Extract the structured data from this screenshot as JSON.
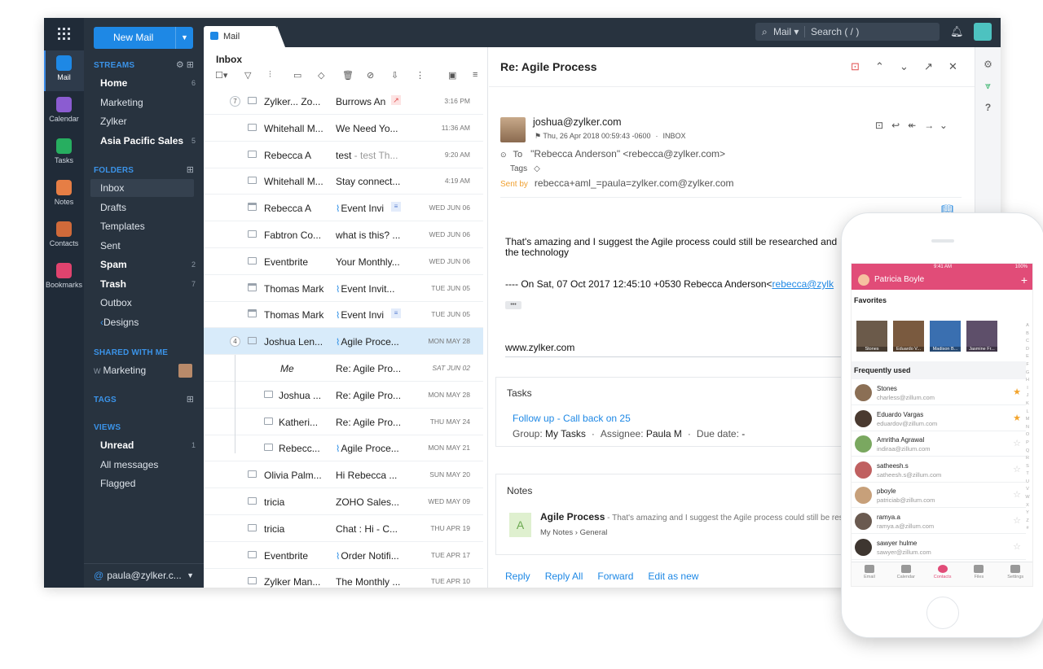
{
  "rail": {
    "items": [
      {
        "label": "Mail",
        "color": "#1e88e5"
      },
      {
        "label": "Calendar",
        "color": "#8b5cd1"
      },
      {
        "label": "Tasks",
        "color": "#27ae60"
      },
      {
        "label": "Notes",
        "color": "#e67e45"
      },
      {
        "label": "Contacts",
        "color": "#d06a3a"
      },
      {
        "label": "Bookmarks",
        "color": "#e0436e"
      }
    ]
  },
  "nav": {
    "new_mail": "New Mail",
    "streams_title": "STREAMS",
    "streams": [
      {
        "label": "Home",
        "count": "6",
        "bold": true
      },
      {
        "label": "Marketing",
        "count": ""
      },
      {
        "label": "Zylker",
        "count": ""
      },
      {
        "label": "Asia Pacific Sales",
        "count": "5",
        "bold": true
      }
    ],
    "folders_title": "FOLDERS",
    "folders": [
      {
        "label": "Inbox",
        "count": ""
      },
      {
        "label": "Drafts",
        "count": ""
      },
      {
        "label": "Templates",
        "count": ""
      },
      {
        "label": "Sent",
        "count": ""
      },
      {
        "label": "Spam",
        "count": "2",
        "bold": true
      },
      {
        "label": "Trash",
        "count": "7",
        "bold": true
      },
      {
        "label": "Outbox",
        "count": ""
      },
      {
        "label": "Designs",
        "count": ""
      }
    ],
    "shared_title": "SHARED WITH ME",
    "shared_prefix": "W",
    "shared_item": "Marketing",
    "tags_title": "TAGS",
    "views_title": "VIEWS",
    "views": [
      {
        "label": "Unread",
        "count": "1",
        "bold": true
      },
      {
        "label": "All messages",
        "count": ""
      },
      {
        "label": "Flagged",
        "count": ""
      }
    ],
    "account": "paula@zylker.c..."
  },
  "topbar": {
    "tab_label": "Mail",
    "search_scope": "Mail",
    "search_placeholder": "Search ( / )"
  },
  "list": {
    "title": "Inbox",
    "rows": [
      {
        "thread": "7",
        "sender": "Zylker... Zo...",
        "subject": "Burrows An",
        "date": "3:16 PM",
        "type": "mail"
      },
      {
        "sender": "Whitehall M...",
        "subject": "We Need Yo...",
        "date": "11:36 AM",
        "type": "mail"
      },
      {
        "sender": "Rebecca A",
        "subject": "test",
        "preview": " - test Th...",
        "date": "9:20 AM",
        "type": "mail"
      },
      {
        "sender": "Whitehall M...",
        "subject": "Stay connect...",
        "date": "4:19 AM",
        "type": "mail"
      },
      {
        "sender": "Rebecca A",
        "subject": "Event Invi",
        "date": "WED JUN 06",
        "type": "cal",
        "clip": true
      },
      {
        "sender": "Fabtron Co...",
        "subject": "what is this? ...",
        "date": "WED JUN 06",
        "type": "mail"
      },
      {
        "sender": "Eventbrite",
        "subject": "Your Monthly...",
        "date": "WED JUN 06",
        "type": "mail"
      },
      {
        "sender": "Thomas Mark",
        "subject": "Event Invit...",
        "date": "TUE JUN 05",
        "type": "cal",
        "clip": true
      },
      {
        "sender": "Thomas Mark",
        "subject": "Event Invi",
        "date": "TUE JUN 05",
        "type": "cal",
        "clip": true
      },
      {
        "thread": "4",
        "sender": "Joshua Len...",
        "subject": "Agile Proce...",
        "date": "MON MAY 28",
        "type": "mail",
        "clip": true,
        "selected": true
      },
      {
        "sender": "Me",
        "subject": "Re: Agile Pro...",
        "date": "SAT JUN 02",
        "type": "me"
      },
      {
        "sender": "Joshua ...",
        "subject": "Re: Agile Pro...",
        "date": "MON MAY 28",
        "type": "child"
      },
      {
        "sender": "Katheri...",
        "subject": "Re: Agile Pro...",
        "date": "THU MAY 24",
        "type": "child"
      },
      {
        "sender": "Rebecc...",
        "subject": "Agile Proce...",
        "date": "MON MAY 21",
        "type": "child",
        "clip": true
      },
      {
        "sender": "Olivia Palm...",
        "subject": "Hi Rebecca ...",
        "date": "SUN MAY 20",
        "type": "mail"
      },
      {
        "sender": "tricia",
        "subject": "ZOHO Sales...",
        "date": "WED MAY 09",
        "type": "mail"
      },
      {
        "sender": "tricia",
        "subject": "Chat : Hi - C...",
        "date": "THU APR 19",
        "type": "mail"
      },
      {
        "sender": "Eventbrite",
        "subject": "Order Notifi...",
        "date": "TUE APR 17",
        "type": "mail",
        "clip": true
      },
      {
        "sender": "Zylker Man...",
        "subject": "The Monthly ...",
        "date": "TUE APR 10",
        "type": "mail"
      }
    ]
  },
  "reading": {
    "subject": "Re: Agile Process",
    "from": "joshua@zylker.com",
    "date_line": "Thu, 26 Apr 2018 00:59:43 -0600",
    "folder": "INBOX",
    "to_label": "To",
    "to_value": "\"Rebecca Anderson\" <rebecca@zylker.com>",
    "tags_label": "Tags",
    "sent_by_label": "Sent by",
    "sent_by_value": "rebecca+aml_=paula=zylker.com@zylker.com",
    "body_line1": "That's amazing  and I suggest the Agile process could still be researched and",
    "body_line2": "the technology",
    "quote_prefix": "---- On Sat, 07 Oct 2017 12:45:10 +0530 Rebecca Anderson<",
    "quote_link": "rebecca@zylk",
    "ellipsis": "•••",
    "signature": "www.zylker.com",
    "tasks_title": "Tasks",
    "task_title": "Follow up - Call back on 25",
    "task_group_label": "Group:",
    "task_group": "My Tasks",
    "task_assignee_label": "Assignee:",
    "task_assignee": "Paula M",
    "task_due_label": "Due date:",
    "task_due": "-",
    "notes_title": "Notes",
    "note_avatar": "A",
    "note_title": "Agile Process",
    "note_preview": " - That's amazing and I suggest the Agile process could still be res",
    "note_path_1": "My Notes",
    "note_path_2": "General",
    "actions": [
      "Reply",
      "Reply All",
      "Forward",
      "Edit as new"
    ]
  },
  "phone": {
    "time": "9:41 AM",
    "battery": "100%",
    "user": "Patricia Boyle",
    "favorites_title": "Favorites",
    "favorites": [
      "Stones",
      "Eduardo V...",
      "Madison B...",
      "Jasmine Fr..."
    ],
    "frequent_title": "Frequently used",
    "contacts": [
      {
        "name": "Stones",
        "email": "charless@zillum.com",
        "starred": true
      },
      {
        "name": "Eduardo Vargas",
        "email": "eduardov@zillum.com",
        "starred": true
      },
      {
        "name": "Amritha Agrawal",
        "email": "indiraa@zillum.com",
        "starred": false
      },
      {
        "name": "satheesh.s",
        "email": "satheesh.s@zillum.com",
        "starred": false
      },
      {
        "name": "pboyle",
        "email": "patriciab@zillum.com",
        "starred": false
      },
      {
        "name": "ramya.a",
        "email": "ramya.a@zillum.com",
        "starred": false
      },
      {
        "name": "sawyer hulme",
        "email": "sawyer@zillum.com",
        "starred": false
      }
    ],
    "tabs": [
      "Email",
      "Calendar",
      "Contacts",
      "Files",
      "Settings"
    ],
    "alpha": [
      "A",
      "B",
      "C",
      "D",
      "E",
      "F",
      "G",
      "H",
      "I",
      "J",
      "K",
      "L",
      "M",
      "N",
      "O",
      "P",
      "Q",
      "R",
      "S",
      "T",
      "U",
      "V",
      "W",
      "X",
      "Y",
      "Z",
      "#"
    ]
  }
}
